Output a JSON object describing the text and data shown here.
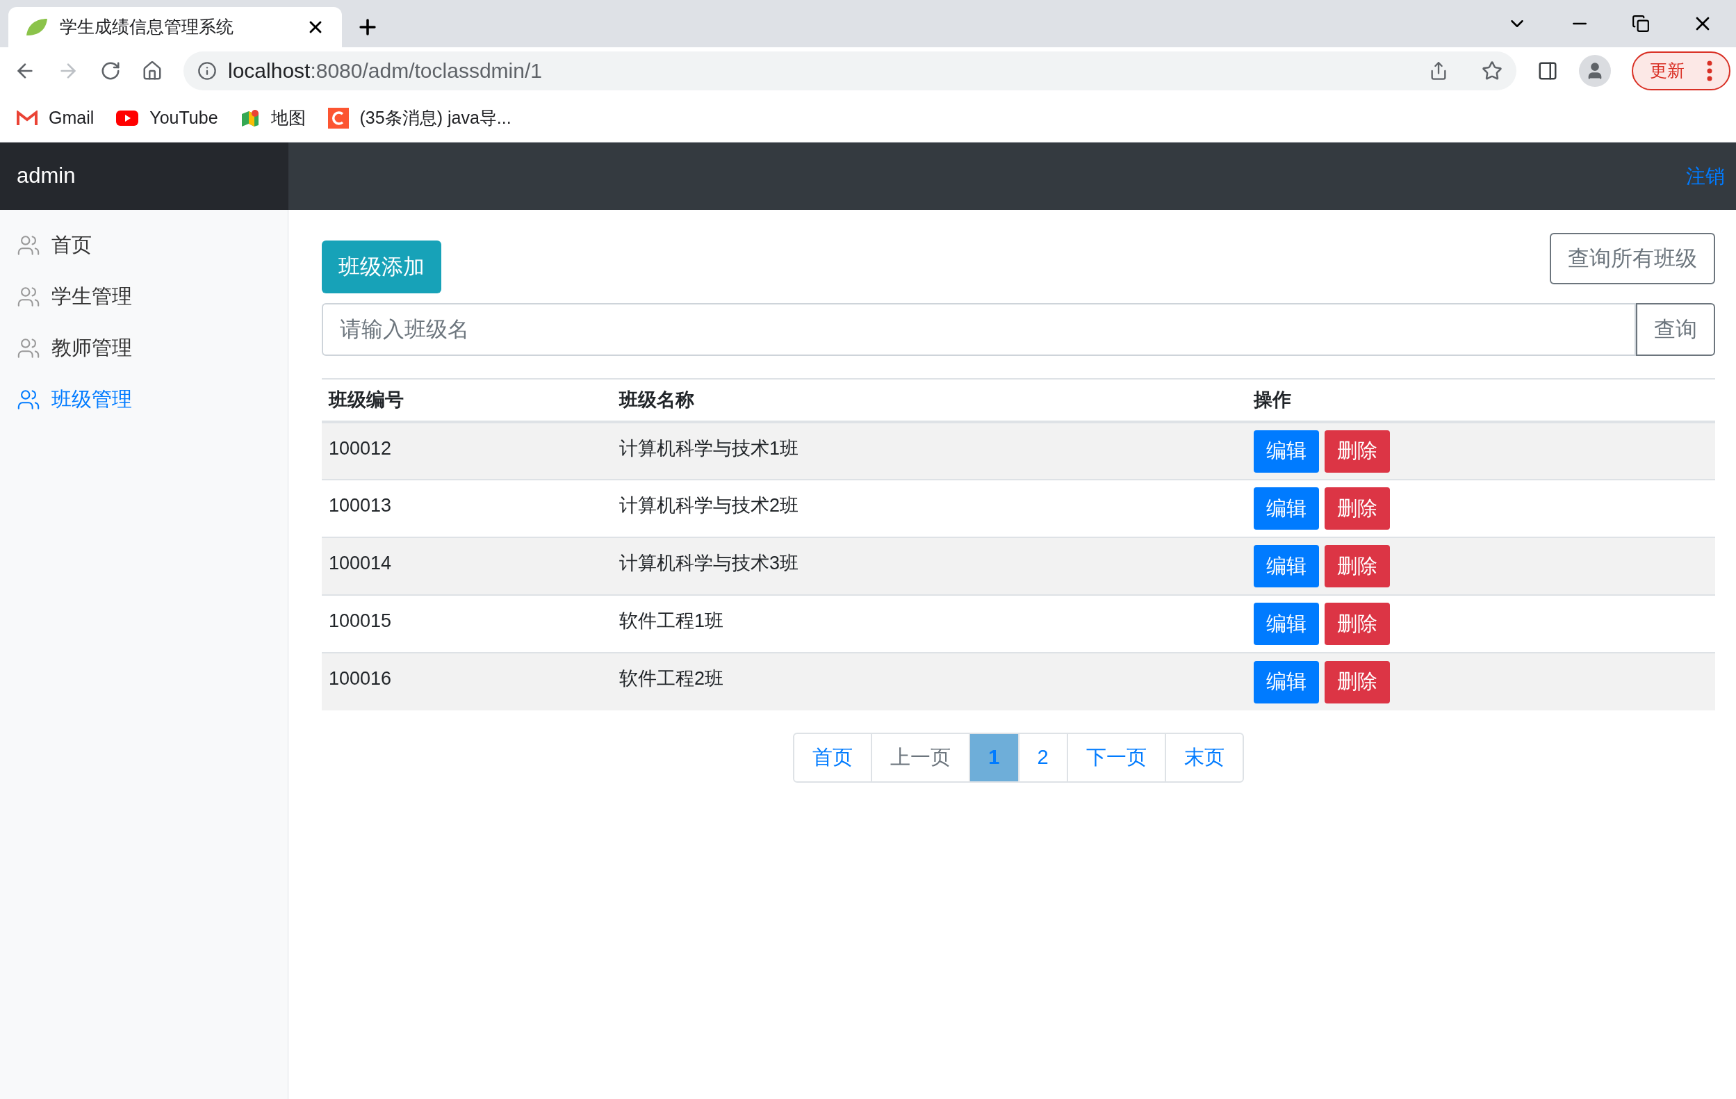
{
  "browser": {
    "tab_title": "学生成绩信息管理系统",
    "url_host": "localhost",
    "url_rest": ":8080/adm/toclassdmin/1",
    "update_button": "更新",
    "bookmarks": [
      {
        "kind": "gmail",
        "label": "Gmail"
      },
      {
        "kind": "youtube",
        "label": "YouTube"
      },
      {
        "kind": "maps",
        "label": "地图"
      },
      {
        "kind": "csdn",
        "label": "(35条消息) java导..."
      }
    ]
  },
  "header": {
    "brand": "admin",
    "logout": "注销"
  },
  "sidebar": {
    "items": [
      {
        "label": "首页",
        "selected": false
      },
      {
        "label": "学生管理",
        "selected": false
      },
      {
        "label": "教师管理",
        "selected": false
      },
      {
        "label": "班级管理",
        "selected": true
      }
    ]
  },
  "toolbar": {
    "add_button": "班级添加",
    "query_all_button": "查询所有班级"
  },
  "search": {
    "placeholder": "请输入班级名",
    "button": "查询"
  },
  "table": {
    "columns": [
      "班级编号",
      "班级名称",
      "操作"
    ],
    "rows": [
      {
        "id": "100012",
        "name": "计算机科学与技术1班",
        "edit": "编辑",
        "delete": "删除"
      },
      {
        "id": "100013",
        "name": "计算机科学与技术2班",
        "edit": "编辑",
        "delete": "删除"
      },
      {
        "id": "100014",
        "name": "计算机科学与技术3班",
        "edit": "编辑",
        "delete": "删除"
      },
      {
        "id": "100015",
        "name": "软件工程1班",
        "edit": "编辑",
        "delete": "删除"
      },
      {
        "id": "100016",
        "name": "软件工程2班",
        "edit": "编辑",
        "delete": "删除"
      }
    ]
  },
  "pagination": [
    {
      "label": "首页",
      "selected": false,
      "disabled": false
    },
    {
      "label": "上一页",
      "selected": false,
      "disabled": true
    },
    {
      "label": "1",
      "selected": true,
      "disabled": false
    },
    {
      "label": "2",
      "selected": false,
      "disabled": false
    },
    {
      "label": "下一页",
      "selected": false,
      "disabled": false
    },
    {
      "label": "末页",
      "selected": false,
      "disabled": false
    }
  ]
}
